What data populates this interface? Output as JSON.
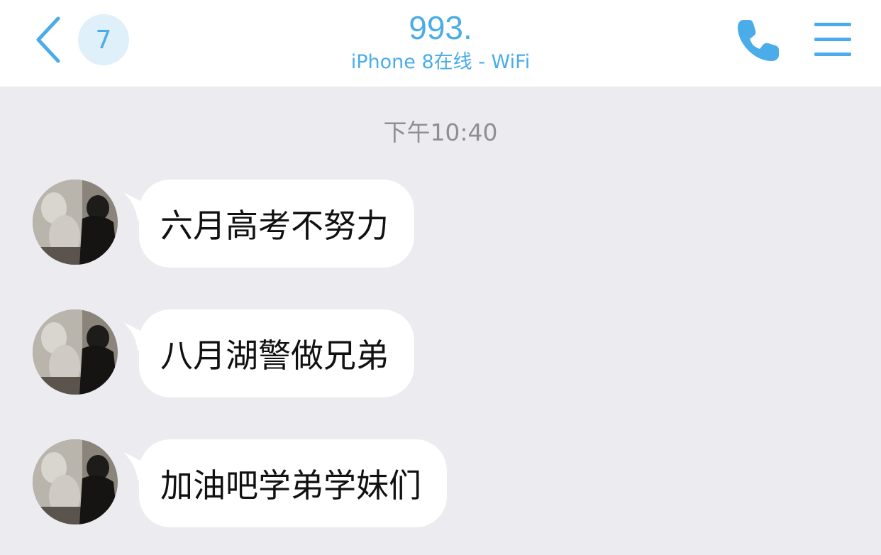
{
  "theme": {
    "accent": "#4aace9",
    "badge_bg": "#dff0fb",
    "chat_bg": "#ebebf0",
    "bubble_bg": "#ffffff",
    "timestamp_color": "#8e8e93"
  },
  "header": {
    "back_icon": "chevron-left-icon",
    "unread_count": "7",
    "contact_name": "993.",
    "contact_status": "iPhone 8在线 - WiFi",
    "call_icon": "phone-icon",
    "menu_icon": "hamburger-menu-icon"
  },
  "chat": {
    "timestamp": "下午10:40",
    "messages": [
      {
        "text": "六月高考不努力",
        "sender": "incoming"
      },
      {
        "text": "八月湖警做兄弟",
        "sender": "incoming"
      },
      {
        "text": "加油吧学弟学妹们",
        "sender": "incoming"
      }
    ]
  }
}
